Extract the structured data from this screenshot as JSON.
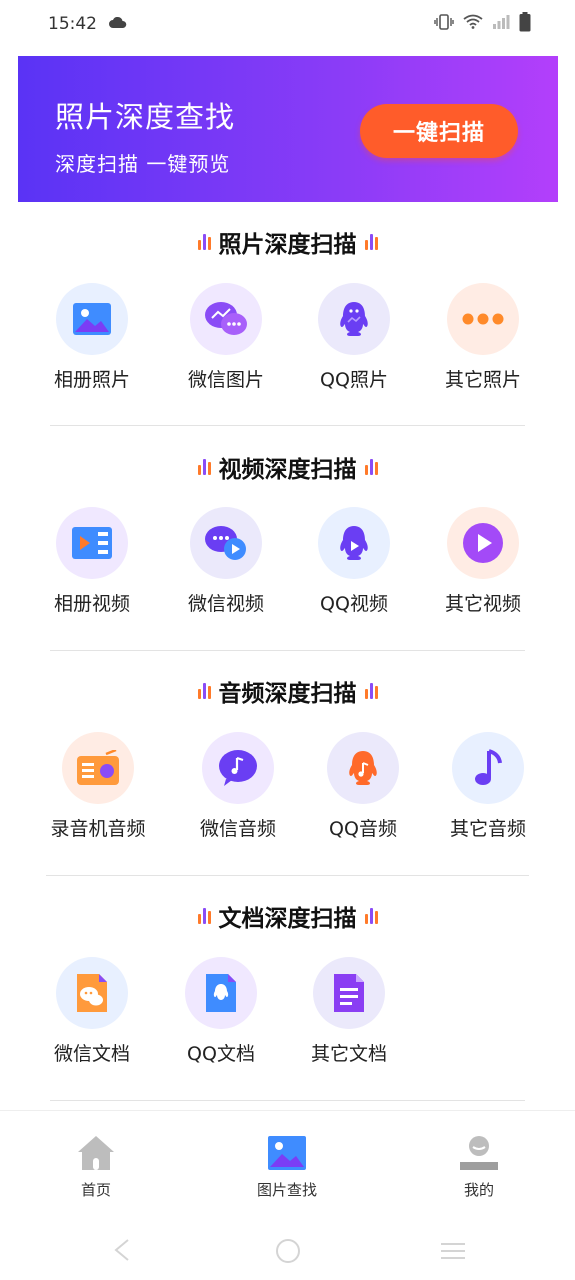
{
  "status": {
    "time": "15:42"
  },
  "banner": {
    "title": "照片深度查找",
    "subtitle": "深度扫描  一键预览",
    "button": "一键扫描"
  },
  "sections": [
    {
      "title": "照片深度扫描",
      "items": [
        {
          "label": "相册照片",
          "icon": "gallery-photo-icon"
        },
        {
          "label": "微信图片",
          "icon": "wechat-image-icon"
        },
        {
          "label": "QQ照片",
          "icon": "qq-photo-icon"
        },
        {
          "label": "其它照片",
          "icon": "more-dots-icon"
        }
      ]
    },
    {
      "title": "视频深度扫描",
      "items": [
        {
          "label": "相册视频",
          "icon": "gallery-video-icon"
        },
        {
          "label": "微信视频",
          "icon": "wechat-video-icon"
        },
        {
          "label": "QQ视频",
          "icon": "qq-video-icon"
        },
        {
          "label": "其它视频",
          "icon": "play-icon"
        }
      ]
    },
    {
      "title": "音频深度扫描",
      "items": [
        {
          "label": "录音机音频",
          "icon": "radio-icon"
        },
        {
          "label": "微信音频",
          "icon": "wechat-audio-icon"
        },
        {
          "label": "QQ音频",
          "icon": "qq-audio-icon"
        },
        {
          "label": "其它音频",
          "icon": "music-note-icon"
        }
      ]
    },
    {
      "title": "文档深度扫描",
      "items": [
        {
          "label": "微信文档",
          "icon": "wechat-doc-icon"
        },
        {
          "label": "QQ文档",
          "icon": "qq-doc-icon"
        },
        {
          "label": "其它文档",
          "icon": "doc-icon"
        }
      ]
    }
  ],
  "nav": {
    "home": "首页",
    "photo_search": "图片查找",
    "mine": "我的"
  },
  "colors": {
    "banner_start": "#5a33f5",
    "banner_end": "#b33ffb",
    "accent_orange": "#ff5c2a",
    "accent_purple": "#8a4cf6"
  }
}
